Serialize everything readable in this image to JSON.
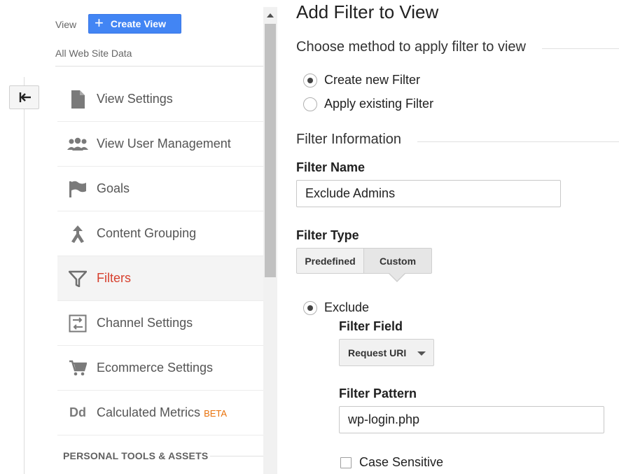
{
  "view": {
    "label": "View",
    "create_button": "Create View",
    "name": "All Web Site Data"
  },
  "nav": {
    "items": [
      {
        "label": "View Settings",
        "icon": "document-icon"
      },
      {
        "label": "View User Management",
        "icon": "people-icon"
      },
      {
        "label": "Goals",
        "icon": "flag-icon"
      },
      {
        "label": "Content Grouping",
        "icon": "merge-icon"
      },
      {
        "label": "Filters",
        "icon": "funnel-icon",
        "active": true
      },
      {
        "label": "Channel Settings",
        "icon": "channel-settings-icon"
      },
      {
        "label": "Ecommerce Settings",
        "icon": "cart-icon"
      },
      {
        "label": "Calculated Metrics",
        "icon": "dd-icon",
        "badge": "BETA"
      }
    ],
    "section_heading": "PERSONAL TOOLS & ASSETS",
    "icon_glyph_dd": "Dd"
  },
  "panel": {
    "title": "Add Filter to View",
    "method_heading": "Choose method to apply filter to view",
    "method_options": [
      {
        "label": "Create new Filter",
        "selected": true
      },
      {
        "label": "Apply existing Filter",
        "selected": false
      }
    ],
    "info_heading": "Filter Information",
    "filter_name_label": "Filter Name",
    "filter_name_value": "Exclude Admins",
    "filter_type_label": "Filter Type",
    "filter_type_tabs": [
      "Predefined",
      "Custom"
    ],
    "filter_type_selected": "Custom",
    "exclude_label": "Exclude",
    "filter_field_label": "Filter Field",
    "filter_field_value": "Request URI",
    "filter_pattern_label": "Filter Pattern",
    "filter_pattern_value": "wp-login.php",
    "case_sensitive_label": "Case Sensitive",
    "case_sensitive_checked": false
  },
  "colors": {
    "accent_blue": "#4285f4",
    "active_red": "#d7402e",
    "beta_orange": "#e8710a"
  }
}
